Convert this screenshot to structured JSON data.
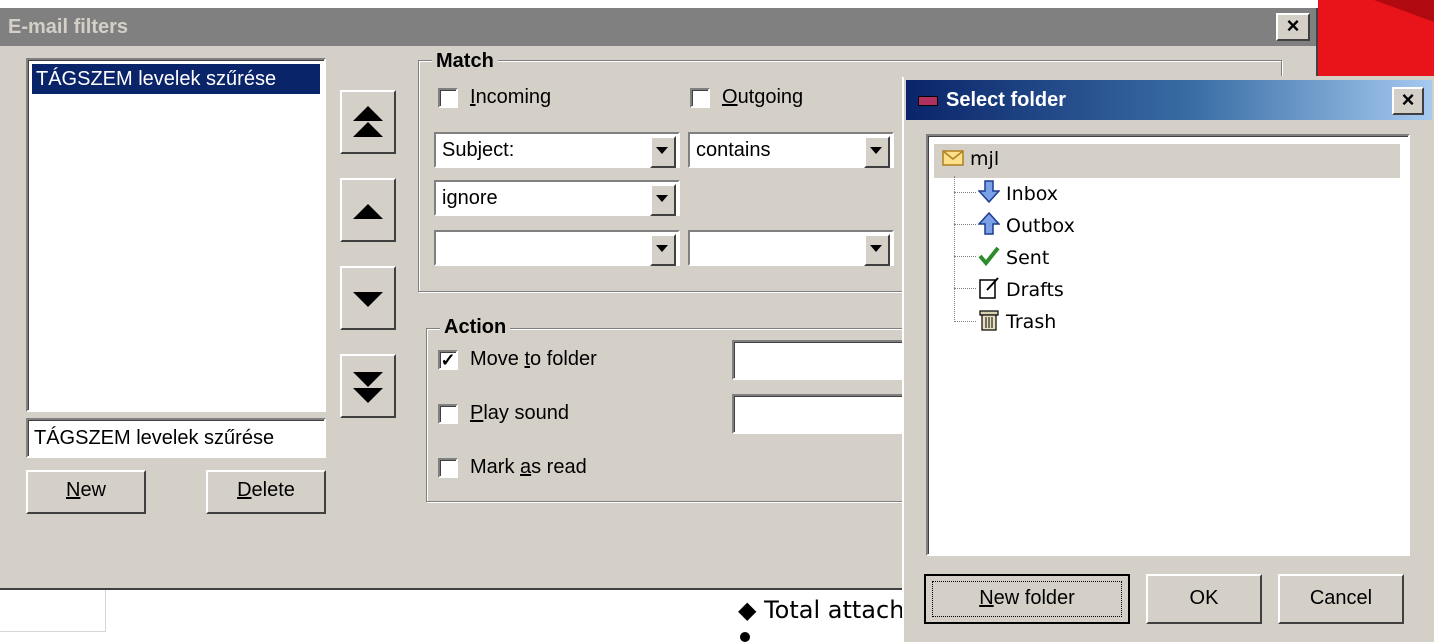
{
  "window": {
    "title": "E-mail filters",
    "close_glyph": "×"
  },
  "filters": {
    "list": [
      "TÁGSZEM levelek szűrése"
    ],
    "name_value": "TÁGSZEM levelek szűrése",
    "new_button": {
      "pre": "",
      "key": "N",
      "post": "ew"
    },
    "delete_button": {
      "pre": "",
      "key": "D",
      "post": "elete"
    }
  },
  "match": {
    "legend": "Match",
    "incoming": {
      "pre": "",
      "key": "I",
      "post": "ncoming",
      "checked": false
    },
    "outgoing": {
      "pre": "",
      "key": "O",
      "post": "utgoing",
      "checked": false
    },
    "field1": "Subject:",
    "operator1": "contains",
    "case_option": "ignore",
    "field2": "",
    "operator2": ""
  },
  "action": {
    "legend": "Action",
    "move_to_folder": {
      "pre": "Move ",
      "key": "t",
      "post": "o folder",
      "checked": true,
      "check_glyph": "✓"
    },
    "play_sound": {
      "pre": "",
      "key": "P",
      "post": "lay sound",
      "checked": false
    },
    "mark_as_read": {
      "pre": "Mark ",
      "key": "a",
      "post": "s read",
      "checked": false
    },
    "folder_value": "",
    "sound_value": ""
  },
  "select_folder": {
    "title": "Select folder",
    "close_glyph": "×",
    "root": {
      "label": "mjl",
      "icon": "envelope-icon"
    },
    "folders": [
      {
        "label": "Inbox",
        "icon": "arrow-down-icon"
      },
      {
        "label": "Outbox",
        "icon": "arrow-up-icon"
      },
      {
        "label": "Sent",
        "icon": "checkmark-icon"
      },
      {
        "label": "Drafts",
        "icon": "note-icon"
      },
      {
        "label": "Trash",
        "icon": "trash-icon"
      }
    ],
    "new_folder_button": {
      "pre": "",
      "key": "N",
      "post": "ew folder"
    },
    "ok_button": "OK",
    "cancel_button": "Cancel"
  },
  "background": {
    "text": "Total attach"
  },
  "colors": {
    "dialog_face": "#d4d0c8",
    "selection": "#0a246a",
    "title_active": "#0a246a",
    "title_inactive": "#808080",
    "accent_red": "#e8141a"
  }
}
